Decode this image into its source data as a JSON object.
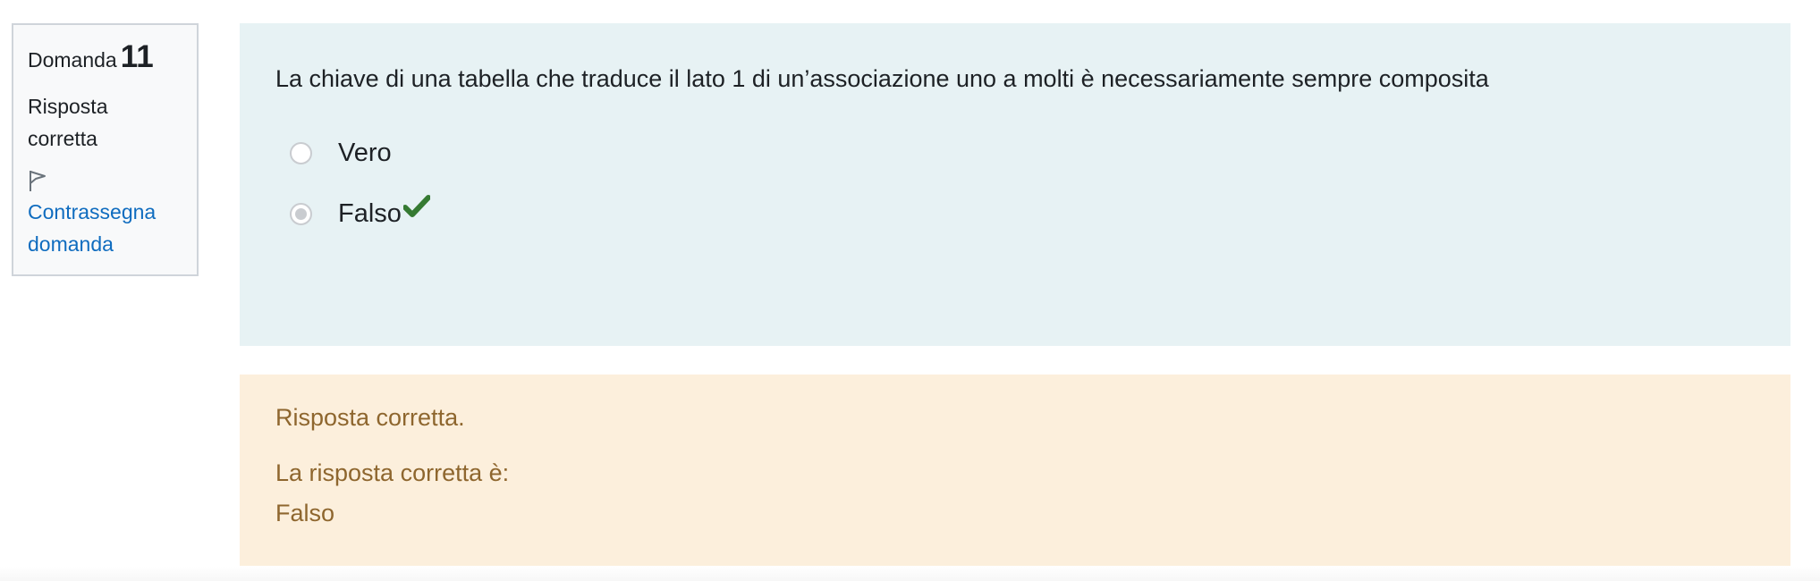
{
  "info": {
    "question_label": "Domanda",
    "question_number": "11",
    "state": "Risposta corretta",
    "flag_label": "Contrassegna domanda"
  },
  "question": {
    "text": "La chiave di una tabella che traduce il lato 1 di un’associazione uno a molti è necessariamente sempre composita",
    "options": [
      {
        "label": "Vero",
        "selected": false
      },
      {
        "label": "Falso",
        "selected": true
      }
    ],
    "correct_icon": "checkmark-icon"
  },
  "outcome": {
    "feedback": "Risposta corretta.",
    "right_answer_intro": "La risposta corretta è:",
    "right_answer_value": "Falso"
  },
  "colors": {
    "formulation_bg": "#e7f2f4",
    "outcome_bg": "#fcefdc",
    "outcome_text": "#8e662e",
    "link": "#0f6cbf",
    "check_green": "#357a32"
  }
}
